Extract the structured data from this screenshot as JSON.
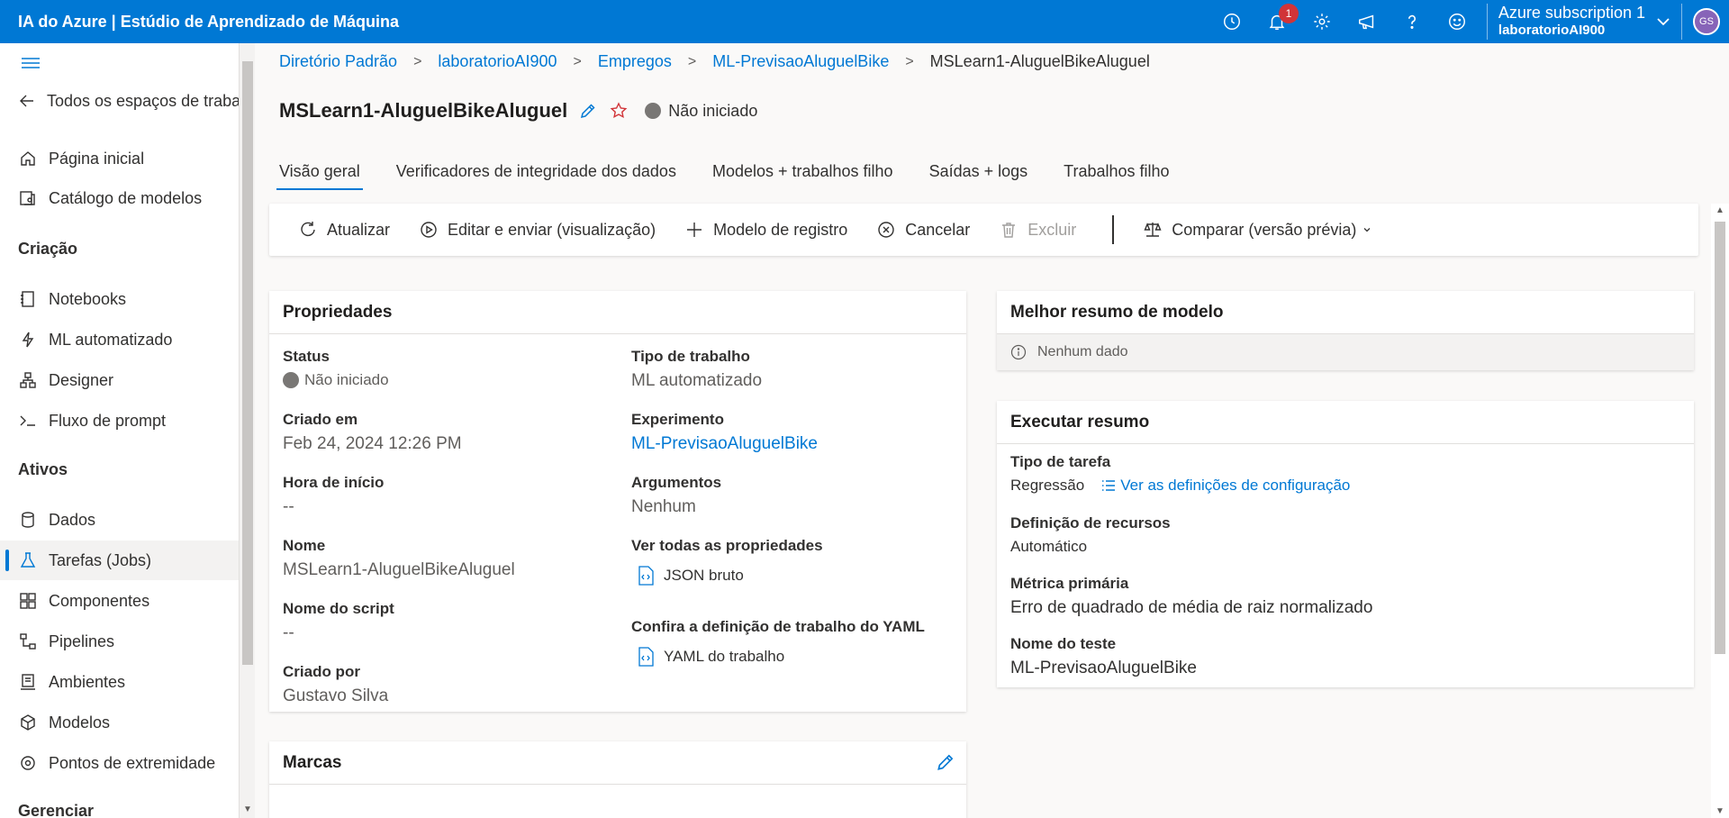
{
  "app": {
    "title": "IA do Azure | Estúdio de Aprendizado de Máquina"
  },
  "topbar": {
    "notification_count": "1",
    "subscription": "Azure subscription 1",
    "workspace": "laboratorioAI900",
    "avatar_initials": "GS",
    "icons": [
      "history-icon",
      "bell-icon",
      "gear-icon",
      "megaphone-icon",
      "help-icon",
      "smiley-icon"
    ]
  },
  "sidebar": {
    "back_label": "Todos os espaços de trabal",
    "home": "Página inicial",
    "catalog": "Catálogo de modelos",
    "section_criacao": "Criação",
    "notebooks": "Notebooks",
    "automl": "ML automatizado",
    "designer": "Designer",
    "prompt_flow": "Fluxo de prompt",
    "section_ativos": "Ativos",
    "dados": "Dados",
    "jobs": "Tarefas (Jobs)",
    "componentes": "Componentes",
    "pipelines": "Pipelines",
    "ambientes": "Ambientes",
    "modelos": "Modelos",
    "endpoints": "Pontos de extremidade",
    "section_gerenciar": "Gerenciar"
  },
  "breadcrumb": {
    "items": [
      "Diretório Padrão",
      "laboratorioAI900",
      "Empregos",
      "ML-PrevisaoAluguelBike"
    ],
    "current": "MSLearn1-AluguelBikeAluguel"
  },
  "page": {
    "title": "MSLearn1-AluguelBikeAluguel",
    "status": "Não iniciado"
  },
  "tabs": [
    "Visão geral",
    "Verificadores de integridade dos dados",
    "Modelos + trabalhos filho",
    "Saídas + logs",
    "Trabalhos filho"
  ],
  "toolbar": {
    "refresh": "Atualizar",
    "edit_submit": "Editar e enviar (visualização)",
    "register_model": "Modelo de registro",
    "cancel": "Cancelar",
    "delete": "Excluir",
    "compare": "Comparar (versão prévia)"
  },
  "properties": {
    "title": "Propriedades",
    "status_label": "Status",
    "status_value": "Não iniciado",
    "created_label": "Criado em",
    "created_value": "Feb 24, 2024 12:26 PM",
    "start_label": "Hora de início",
    "start_value": "--",
    "name_label": "Nome",
    "name_value": "MSLearn1-AluguelBikeAluguel",
    "script_label": "Nome do script",
    "script_value": "--",
    "created_by_label": "Criado por",
    "created_by_value": "Gustavo Silva",
    "job_type_label": "Tipo de trabalho",
    "job_type_value": "ML automatizado",
    "experiment_label": "Experimento",
    "experiment_value": "ML-PrevisaoAluguelBike",
    "args_label": "Argumentos",
    "args_value": "Nenhum",
    "all_props_label": "Ver todas as propriedades",
    "raw_json": "JSON bruto",
    "yaml_label": "Confira a definição de trabalho do YAML",
    "yaml_value": "YAML do trabalho"
  },
  "tags": {
    "title": "Marcas"
  },
  "best_model": {
    "title": "Melhor resumo de modelo",
    "no_data": "Nenhum dado"
  },
  "run_summary": {
    "title": "Executar resumo",
    "task_type_label": "Tipo de tarefa",
    "task_type_value": "Regressão",
    "config_link": "Ver as definições de configuração",
    "resources_label": "Definição de recursos",
    "resources_value": "Automático",
    "metric_label": "Métrica primária",
    "metric_value": "Erro de quadrado de média de raiz normalizado",
    "test_label": "Nome do teste",
    "test_value": "ML-PrevisaoAluguelBike"
  }
}
